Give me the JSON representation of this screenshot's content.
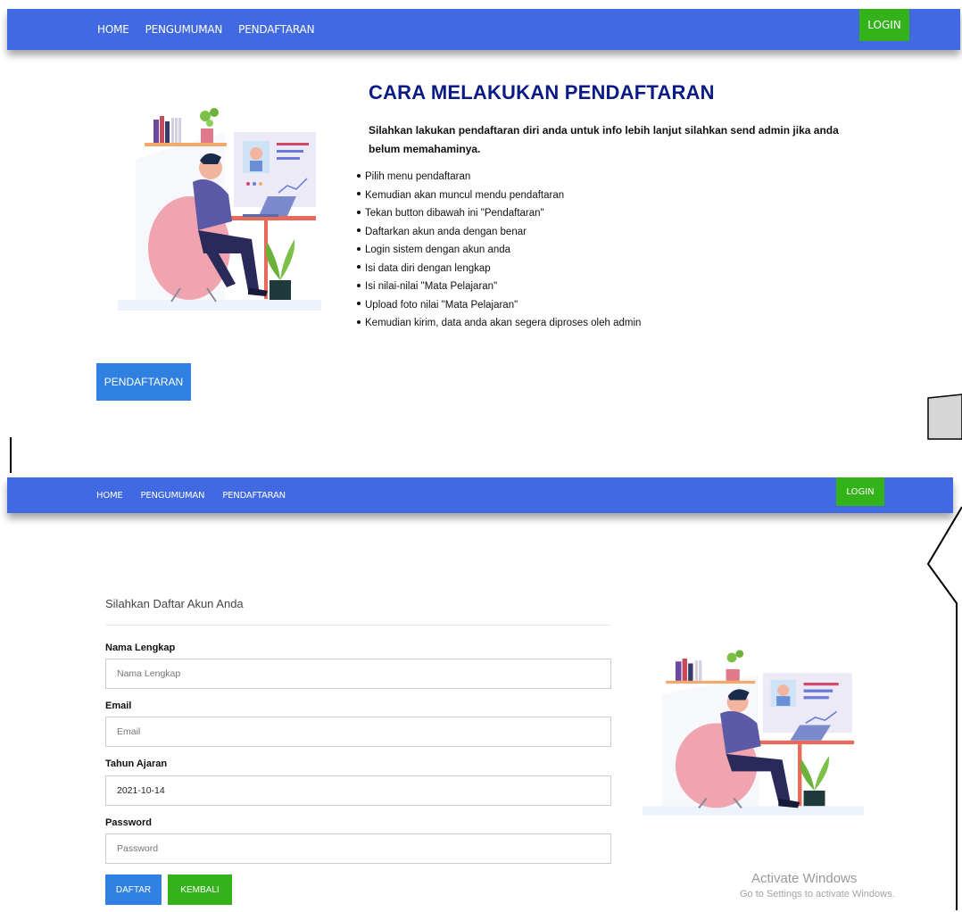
{
  "nav_top": {
    "links": [
      "HOME",
      "PENGUMUMAN",
      "PENDAFTARAN"
    ],
    "login_label": "LOGIN",
    "color": "#4169e1"
  },
  "info": {
    "title": "CARA MELAKUKAN PENDAFTARAN",
    "subtitle": "Silahkan lakukan pendaftaran diri anda untuk info lebih lanjut silahkan send admin jika anda belum memahaminya.",
    "steps": [
      "Pilih menu pendaftaran",
      "Kemudian akan muncul mendu pendaftaran",
      "Tekan button dibawah ini \"Pendaftaran\"",
      "Daftarkan akun anda dengan benar",
      "Login sistem dengan akun anda",
      "Isi data diri dengan lengkap",
      "Isi nilai-nilai \"Mata Pelajaran\"",
      "Upload foto nilai \"Mata Pelajaran\"",
      "Kemudian kirim, data anda akan segera diproses oleh admin"
    ],
    "button_label": "PENDAFTARAN"
  },
  "nav_bottom": {
    "links": [
      "HOME",
      "PENGUMUMAN",
      "PENDAFTARAN"
    ],
    "login_label": "LOGIN"
  },
  "form": {
    "heading": "Silahkan Daftar Akun Anda",
    "fields": [
      {
        "label": "Nama Lengkap",
        "placeholder": "Nama Lengkap",
        "value": ""
      },
      {
        "label": "Email",
        "placeholder": "Email",
        "value": ""
      },
      {
        "label": "Tahun Ajaran",
        "placeholder": "",
        "value": "2021-10-14"
      },
      {
        "label": "Password",
        "placeholder": "Password",
        "value": ""
      }
    ],
    "submit_label": "DAFTAR",
    "back_label": "KEMBALI"
  },
  "watermark": {
    "title": "Activate Windows",
    "subtitle": "Go to Settings to activate Windows."
  },
  "colors": {
    "nav": "#4169e1",
    "login": "#33b21a",
    "primary_button": "#2f80e0",
    "title": "#0a1a86"
  }
}
